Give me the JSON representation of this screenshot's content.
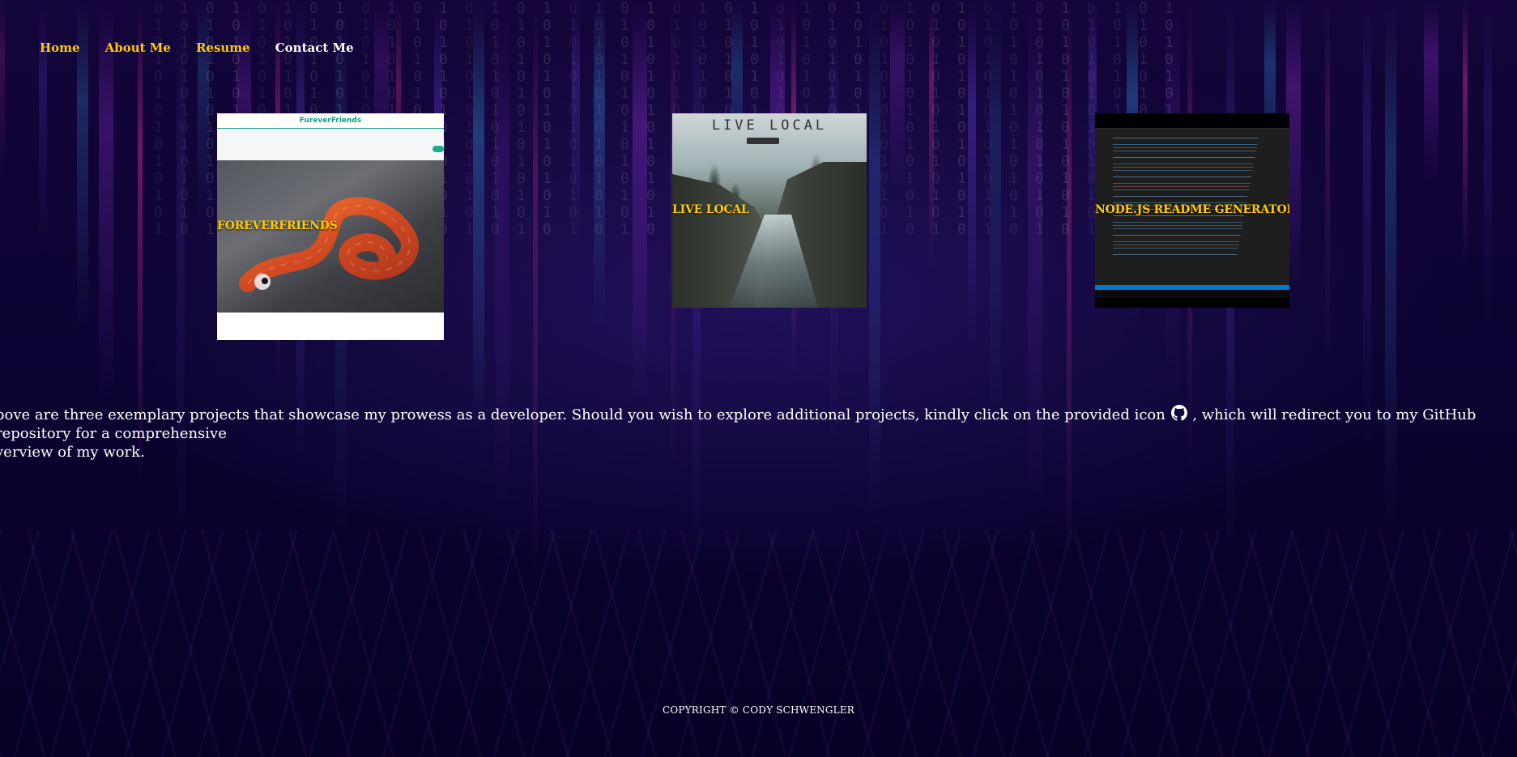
{
  "nav": {
    "items": [
      {
        "label": "Home"
      },
      {
        "label": "About Me"
      },
      {
        "label": "Resume"
      },
      {
        "label": "Contact Me"
      }
    ]
  },
  "projects": [
    {
      "title": "FOREVERFRIENDS",
      "thumb_brand": "FureverFriends"
    },
    {
      "title": "LIVE LOCAL",
      "thumb_brand": "LIVE LOCAL"
    },
    {
      "title": "NODE.JS README GENERATOR"
    }
  ],
  "intro": {
    "before_icon": "bove are three exemplary projects that showcase my prowess as a developer. Should you wish to explore additional projects, kindly click on the provided icon",
    "after_icon": ", which will redirect you to my GitHub repository for a comprehensive",
    "line2": "verview of my work."
  },
  "footer": {
    "copyright": "COPYRIGHT © CODY SCHWENGLER"
  },
  "colors": {
    "accent": "#ffcc00",
    "nav_active": "#ffffff",
    "background_top": "#14053a",
    "background_bottom": "#070124"
  },
  "icons": {
    "github_icon": "github-icon"
  }
}
